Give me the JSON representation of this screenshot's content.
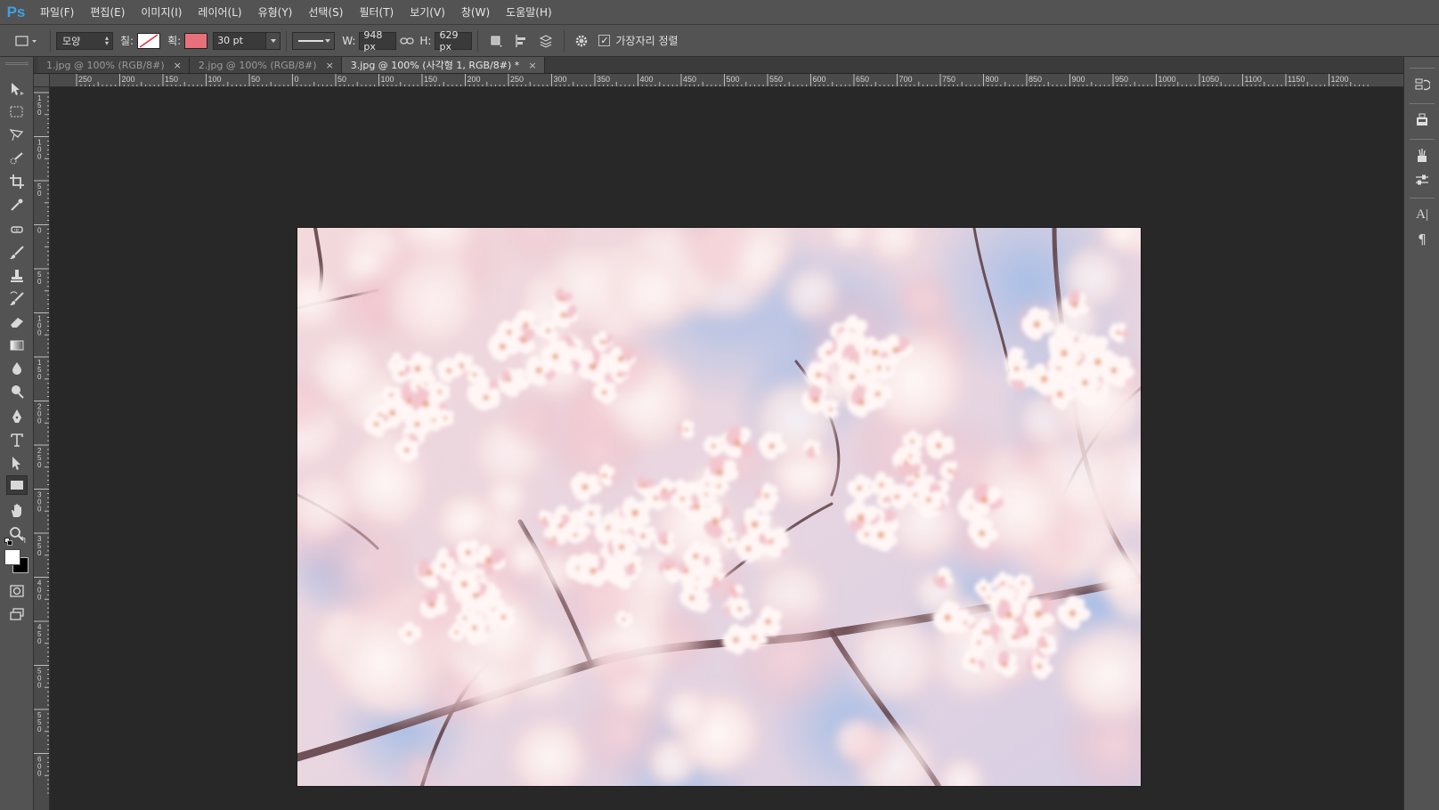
{
  "app": {
    "logo": "Ps"
  },
  "menu": [
    "파일(F)",
    "편집(E)",
    "이미지(I)",
    "레이어(L)",
    "유형(Y)",
    "선택(S)",
    "필터(T)",
    "보기(V)",
    "창(W)",
    "도움말(H)"
  ],
  "options": {
    "mode": "모양",
    "fill_label": "칠:",
    "stroke_label": "획:",
    "stroke_size": "30 pt",
    "w_label": "W:",
    "w_value": "948 px",
    "h_label": "H:",
    "h_value": "629 px",
    "align_edges": "가장자리 정렬",
    "stroke_color": "#e8707a"
  },
  "tabs": [
    {
      "label": "1.jpg @ 100% (RGB/8#)",
      "active": false
    },
    {
      "label": "2.jpg @ 100% (RGB/8#)",
      "active": false
    },
    {
      "label": "3.jpg @ 100% (사각형 1, RGB/8#) *",
      "active": true
    }
  ],
  "tab_close": "×",
  "ruler_h": [
    "250",
    "200",
    "150",
    "100",
    "50",
    "0",
    "50",
    "100",
    "150",
    "200",
    "250",
    "300",
    "350",
    "400",
    "450",
    "500",
    "550",
    "600",
    "650",
    "700",
    "750",
    "800",
    "850",
    "900",
    "950",
    "1000",
    "1050",
    "1100",
    "1150",
    "1200"
  ],
  "ruler_v": [
    "150",
    "100",
    "50",
    "0",
    "50",
    "100",
    "150",
    "200",
    "250",
    "300",
    "350",
    "400",
    "450",
    "500",
    "550",
    "600"
  ],
  "dock_icons": [
    "history-icon",
    "layer-comps-icon",
    "brush-presets-icon",
    "adjustments-icon",
    "character-icon",
    "paragraph-icon"
  ],
  "dock_labels": {
    "character": "A|",
    "paragraph": "¶"
  }
}
